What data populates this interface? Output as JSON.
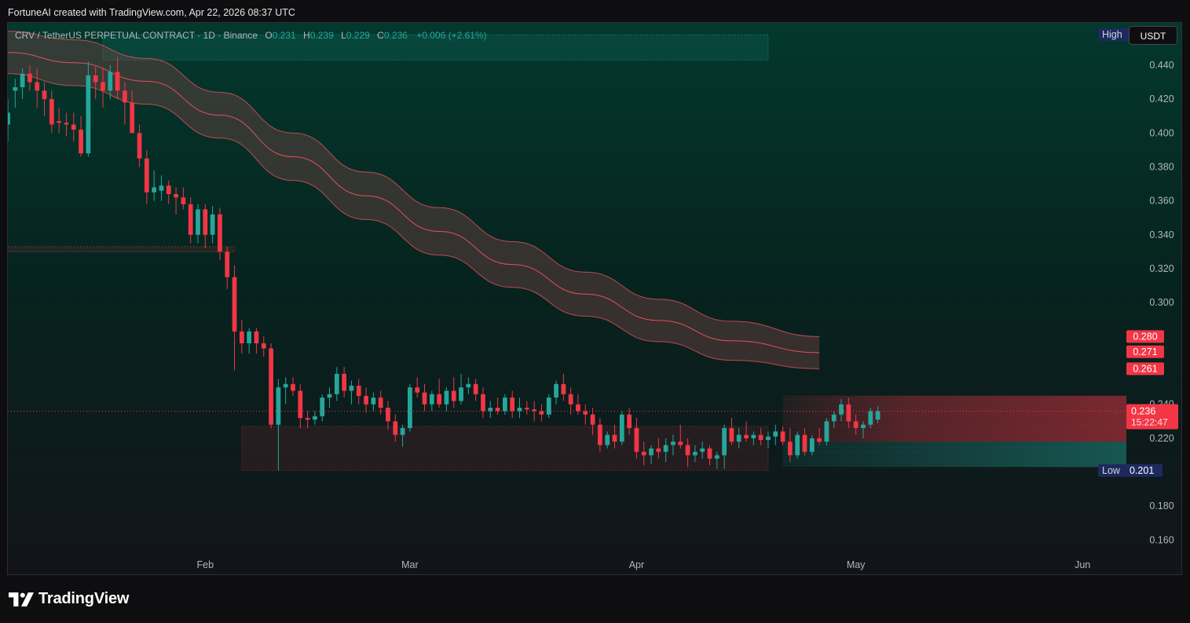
{
  "credit": "FortuneAI created with TradingView.com, Apr 22, 2026 08:37 UTC",
  "legend": {
    "symbol": "CRV / TetherUS PERPETUAL CONTRACT · 1D · Binance",
    "o_label": "O",
    "o": "0.231",
    "h_label": "H",
    "h": "0.239",
    "l_label": "L",
    "l": "0.229",
    "c_label": "C",
    "c": "0.236",
    "change": "+0.006 (+2.61%)"
  },
  "currency": "USDT",
  "brand": "TradingView",
  "colors": {
    "up": "#26a69a",
    "down": "#f23645",
    "band": "#f7525f",
    "bg_top": "#03352c",
    "bg_bottom": "#121419"
  },
  "chart_data": {
    "type": "candlestick",
    "ylim": [
      0.15,
      0.465
    ],
    "y_ticks": [
      "0.440",
      "0.420",
      "0.400",
      "0.380",
      "0.360",
      "0.340",
      "0.320",
      "0.300",
      "0.240",
      "0.220",
      "0.180",
      "0.160"
    ],
    "x_labels": [
      {
        "label": "Feb",
        "day": 18
      },
      {
        "label": "Mar",
        "day": 46
      },
      {
        "label": "Apr",
        "day": 77
      },
      {
        "label": "May",
        "day": 107
      },
      {
        "label": "Jun",
        "day": 138
      }
    ],
    "x_range": [
      -9,
      144
    ],
    "high": {
      "label": "High",
      "value": 0.458
    },
    "low": {
      "label": "Low",
      "value": 0.201
    },
    "price_tags": [
      {
        "value": "0.280",
        "price": 0.28
      },
      {
        "value": "0.271",
        "price": 0.271
      },
      {
        "value": "0.261",
        "price": 0.261
      }
    ],
    "last": {
      "value": "0.236",
      "price": 0.236,
      "countdown": "15:22:47"
    },
    "zones": [
      {
        "kind": "supply",
        "day_from": 4,
        "day_to": 95,
        "top": 0.458,
        "bottom": 0.443
      },
      {
        "kind": "level",
        "day_from": -9,
        "day_to": 22,
        "top": 0.333,
        "bottom": 0.33
      },
      {
        "kind": "demand",
        "day_from": 23,
        "day_to": 95,
        "top": 0.227,
        "bottom": 0.201
      }
    ],
    "band": [
      {
        "day": -9,
        "upper": 0.46,
        "lower": 0.435
      },
      {
        "day": 0,
        "upper": 0.455,
        "lower": 0.428
      },
      {
        "day": 10,
        "upper": 0.444,
        "lower": 0.417
      },
      {
        "day": 20,
        "upper": 0.424,
        "lower": 0.397
      },
      {
        "day": 30,
        "upper": 0.4,
        "lower": 0.372
      },
      {
        "day": 40,
        "upper": 0.377,
        "lower": 0.349
      },
      {
        "day": 50,
        "upper": 0.356,
        "lower": 0.328
      },
      {
        "day": 60,
        "upper": 0.336,
        "lower": 0.309
      },
      {
        "day": 70,
        "upper": 0.318,
        "lower": 0.292
      },
      {
        "day": 80,
        "upper": 0.302,
        "lower": 0.277
      },
      {
        "day": 90,
        "upper": 0.289,
        "lower": 0.266
      },
      {
        "day": 102,
        "upper": 0.28,
        "lower": 0.261
      }
    ],
    "candles": [
      {
        "d": -9,
        "o": 0.405,
        "h": 0.42,
        "l": 0.395,
        "c": 0.412
      },
      {
        "d": -8,
        "o": 0.425,
        "h": 0.432,
        "l": 0.415,
        "c": 0.427
      },
      {
        "d": -7,
        "o": 0.427,
        "h": 0.438,
        "l": 0.42,
        "c": 0.435
      },
      {
        "d": -6,
        "o": 0.435,
        "h": 0.44,
        "l": 0.425,
        "c": 0.43
      },
      {
        "d": -5,
        "o": 0.43,
        "h": 0.438,
        "l": 0.415,
        "c": 0.425
      },
      {
        "d": -4,
        "o": 0.425,
        "h": 0.43,
        "l": 0.41,
        "c": 0.42
      },
      {
        "d": -3,
        "o": 0.42,
        "h": 0.425,
        "l": 0.4,
        "c": 0.405
      },
      {
        "d": -2,
        "o": 0.407,
        "h": 0.415,
        "l": 0.4,
        "c": 0.406
      },
      {
        "d": -1,
        "o": 0.406,
        "h": 0.412,
        "l": 0.398,
        "c": 0.405
      },
      {
        "d": 0,
        "o": 0.405,
        "h": 0.412,
        "l": 0.395,
        "c": 0.402
      },
      {
        "d": 1,
        "o": 0.402,
        "h": 0.41,
        "l": 0.386,
        "c": 0.388
      },
      {
        "d": 2,
        "o": 0.388,
        "h": 0.442,
        "l": 0.386,
        "c": 0.434
      },
      {
        "d": 3,
        "o": 0.434,
        "h": 0.44,
        "l": 0.42,
        "c": 0.43
      },
      {
        "d": 4,
        "o": 0.43,
        "h": 0.438,
        "l": 0.415,
        "c": 0.425
      },
      {
        "d": 5,
        "o": 0.425,
        "h": 0.44,
        "l": 0.42,
        "c": 0.436
      },
      {
        "d": 6,
        "o": 0.436,
        "h": 0.445,
        "l": 0.42,
        "c": 0.425
      },
      {
        "d": 7,
        "o": 0.425,
        "h": 0.43,
        "l": 0.405,
        "c": 0.418
      },
      {
        "d": 8,
        "o": 0.418,
        "h": 0.425,
        "l": 0.4,
        "c": 0.4
      },
      {
        "d": 9,
        "o": 0.4,
        "h": 0.405,
        "l": 0.38,
        "c": 0.385
      },
      {
        "d": 10,
        "o": 0.385,
        "h": 0.39,
        "l": 0.358,
        "c": 0.365
      },
      {
        "d": 11,
        "o": 0.365,
        "h": 0.378,
        "l": 0.36,
        "c": 0.368
      },
      {
        "d": 12,
        "o": 0.366,
        "h": 0.375,
        "l": 0.36,
        "c": 0.369
      },
      {
        "d": 13,
        "o": 0.369,
        "h": 0.372,
        "l": 0.358,
        "c": 0.364
      },
      {
        "d": 14,
        "o": 0.364,
        "h": 0.368,
        "l": 0.352,
        "c": 0.362
      },
      {
        "d": 15,
        "o": 0.362,
        "h": 0.368,
        "l": 0.355,
        "c": 0.358
      },
      {
        "d": 16,
        "o": 0.358,
        "h": 0.362,
        "l": 0.335,
        "c": 0.34
      },
      {
        "d": 17,
        "o": 0.34,
        "h": 0.358,
        "l": 0.335,
        "c": 0.355
      },
      {
        "d": 18,
        "o": 0.355,
        "h": 0.358,
        "l": 0.332,
        "c": 0.34
      },
      {
        "d": 19,
        "o": 0.34,
        "h": 0.357,
        "l": 0.335,
        "c": 0.352
      },
      {
        "d": 20,
        "o": 0.352,
        "h": 0.356,
        "l": 0.325,
        "c": 0.33
      },
      {
        "d": 21,
        "o": 0.33,
        "h": 0.333,
        "l": 0.308,
        "c": 0.315
      },
      {
        "d": 22,
        "o": 0.315,
        "h": 0.322,
        "l": 0.26,
        "c": 0.283
      },
      {
        "d": 23,
        "o": 0.283,
        "h": 0.29,
        "l": 0.27,
        "c": 0.276
      },
      {
        "d": 24,
        "o": 0.276,
        "h": 0.285,
        "l": 0.27,
        "c": 0.283
      },
      {
        "d": 25,
        "o": 0.283,
        "h": 0.285,
        "l": 0.27,
        "c": 0.276
      },
      {
        "d": 26,
        "o": 0.276,
        "h": 0.28,
        "l": 0.268,
        "c": 0.273
      },
      {
        "d": 27,
        "o": 0.273,
        "h": 0.276,
        "l": 0.226,
        "c": 0.228
      },
      {
        "d": 28,
        "o": 0.228,
        "h": 0.255,
        "l": 0.201,
        "c": 0.25
      },
      {
        "d": 29,
        "o": 0.25,
        "h": 0.256,
        "l": 0.24,
        "c": 0.252
      },
      {
        "d": 30,
        "o": 0.252,
        "h": 0.256,
        "l": 0.245,
        "c": 0.248
      },
      {
        "d": 31,
        "o": 0.248,
        "h": 0.252,
        "l": 0.226,
        "c": 0.232
      },
      {
        "d": 32,
        "o": 0.232,
        "h": 0.236,
        "l": 0.226,
        "c": 0.231
      },
      {
        "d": 33,
        "o": 0.231,
        "h": 0.236,
        "l": 0.228,
        "c": 0.233
      },
      {
        "d": 34,
        "o": 0.233,
        "h": 0.246,
        "l": 0.23,
        "c": 0.244
      },
      {
        "d": 35,
        "o": 0.244,
        "h": 0.25,
        "l": 0.238,
        "c": 0.246
      },
      {
        "d": 36,
        "o": 0.246,
        "h": 0.262,
        "l": 0.242,
        "c": 0.258
      },
      {
        "d": 37,
        "o": 0.258,
        "h": 0.262,
        "l": 0.244,
        "c": 0.248
      },
      {
        "d": 38,
        "o": 0.248,
        "h": 0.254,
        "l": 0.24,
        "c": 0.251
      },
      {
        "d": 39,
        "o": 0.251,
        "h": 0.255,
        "l": 0.24,
        "c": 0.245
      },
      {
        "d": 40,
        "o": 0.245,
        "h": 0.25,
        "l": 0.235,
        "c": 0.24
      },
      {
        "d": 41,
        "o": 0.24,
        "h": 0.247,
        "l": 0.236,
        "c": 0.244
      },
      {
        "d": 42,
        "o": 0.244,
        "h": 0.248,
        "l": 0.234,
        "c": 0.238
      },
      {
        "d": 43,
        "o": 0.238,
        "h": 0.242,
        "l": 0.225,
        "c": 0.23
      },
      {
        "d": 44,
        "o": 0.23,
        "h": 0.234,
        "l": 0.218,
        "c": 0.222
      },
      {
        "d": 45,
        "o": 0.222,
        "h": 0.228,
        "l": 0.215,
        "c": 0.226
      },
      {
        "d": 46,
        "o": 0.226,
        "h": 0.252,
        "l": 0.224,
        "c": 0.25
      },
      {
        "d": 47,
        "o": 0.25,
        "h": 0.256,
        "l": 0.244,
        "c": 0.247
      },
      {
        "d": 48,
        "o": 0.247,
        "h": 0.252,
        "l": 0.236,
        "c": 0.24
      },
      {
        "d": 49,
        "o": 0.24,
        "h": 0.248,
        "l": 0.236,
        "c": 0.246
      },
      {
        "d": 50,
        "o": 0.246,
        "h": 0.255,
        "l": 0.238,
        "c": 0.24
      },
      {
        "d": 51,
        "o": 0.24,
        "h": 0.25,
        "l": 0.236,
        "c": 0.248
      },
      {
        "d": 52,
        "o": 0.248,
        "h": 0.256,
        "l": 0.238,
        "c": 0.242
      },
      {
        "d": 53,
        "o": 0.242,
        "h": 0.258,
        "l": 0.24,
        "c": 0.25
      },
      {
        "d": 54,
        "o": 0.25,
        "h": 0.256,
        "l": 0.246,
        "c": 0.252
      },
      {
        "d": 55,
        "o": 0.252,
        "h": 0.255,
        "l": 0.242,
        "c": 0.246
      },
      {
        "d": 56,
        "o": 0.246,
        "h": 0.25,
        "l": 0.232,
        "c": 0.236
      },
      {
        "d": 57,
        "o": 0.236,
        "h": 0.242,
        "l": 0.232,
        "c": 0.238
      },
      {
        "d": 58,
        "o": 0.238,
        "h": 0.244,
        "l": 0.234,
        "c": 0.236
      },
      {
        "d": 59,
        "o": 0.236,
        "h": 0.246,
        "l": 0.234,
        "c": 0.244
      },
      {
        "d": 60,
        "o": 0.244,
        "h": 0.248,
        "l": 0.232,
        "c": 0.236
      },
      {
        "d": 61,
        "o": 0.236,
        "h": 0.244,
        "l": 0.232,
        "c": 0.238
      },
      {
        "d": 62,
        "o": 0.238,
        "h": 0.242,
        "l": 0.234,
        "c": 0.237
      },
      {
        "d": 63,
        "o": 0.237,
        "h": 0.242,
        "l": 0.23,
        "c": 0.236
      },
      {
        "d": 64,
        "o": 0.236,
        "h": 0.24,
        "l": 0.23,
        "c": 0.234
      },
      {
        "d": 65,
        "o": 0.234,
        "h": 0.246,
        "l": 0.232,
        "c": 0.244
      },
      {
        "d": 66,
        "o": 0.244,
        "h": 0.254,
        "l": 0.24,
        "c": 0.252
      },
      {
        "d": 67,
        "o": 0.252,
        "h": 0.258,
        "l": 0.242,
        "c": 0.246
      },
      {
        "d": 68,
        "o": 0.246,
        "h": 0.25,
        "l": 0.234,
        "c": 0.24
      },
      {
        "d": 69,
        "o": 0.24,
        "h": 0.246,
        "l": 0.234,
        "c": 0.236
      },
      {
        "d": 70,
        "o": 0.236,
        "h": 0.24,
        "l": 0.228,
        "c": 0.234
      },
      {
        "d": 71,
        "o": 0.234,
        "h": 0.238,
        "l": 0.222,
        "c": 0.228
      },
      {
        "d": 72,
        "o": 0.228,
        "h": 0.232,
        "l": 0.212,
        "c": 0.216
      },
      {
        "d": 73,
        "o": 0.216,
        "h": 0.224,
        "l": 0.214,
        "c": 0.222
      },
      {
        "d": 74,
        "o": 0.222,
        "h": 0.228,
        "l": 0.214,
        "c": 0.218
      },
      {
        "d": 75,
        "o": 0.218,
        "h": 0.236,
        "l": 0.216,
        "c": 0.234
      },
      {
        "d": 76,
        "o": 0.234,
        "h": 0.238,
        "l": 0.222,
        "c": 0.226
      },
      {
        "d": 77,
        "o": 0.226,
        "h": 0.232,
        "l": 0.208,
        "c": 0.212
      },
      {
        "d": 78,
        "o": 0.212,
        "h": 0.218,
        "l": 0.204,
        "c": 0.21
      },
      {
        "d": 79,
        "o": 0.21,
        "h": 0.216,
        "l": 0.205,
        "c": 0.214
      },
      {
        "d": 80,
        "o": 0.214,
        "h": 0.22,
        "l": 0.208,
        "c": 0.212
      },
      {
        "d": 81,
        "o": 0.212,
        "h": 0.22,
        "l": 0.206,
        "c": 0.216
      },
      {
        "d": 82,
        "o": 0.216,
        "h": 0.222,
        "l": 0.21,
        "c": 0.218
      },
      {
        "d": 83,
        "o": 0.218,
        "h": 0.228,
        "l": 0.214,
        "c": 0.216
      },
      {
        "d": 84,
        "o": 0.216,
        "h": 0.22,
        "l": 0.203,
        "c": 0.21
      },
      {
        "d": 85,
        "o": 0.21,
        "h": 0.216,
        "l": 0.206,
        "c": 0.212
      },
      {
        "d": 86,
        "o": 0.212,
        "h": 0.218,
        "l": 0.208,
        "c": 0.214
      },
      {
        "d": 87,
        "o": 0.214,
        "h": 0.216,
        "l": 0.204,
        "c": 0.208
      },
      {
        "d": 88,
        "o": 0.208,
        "h": 0.212,
        "l": 0.202,
        "c": 0.21
      },
      {
        "d": 89,
        "o": 0.21,
        "h": 0.228,
        "l": 0.202,
        "c": 0.226
      },
      {
        "d": 90,
        "o": 0.226,
        "h": 0.232,
        "l": 0.216,
        "c": 0.218
      },
      {
        "d": 91,
        "o": 0.218,
        "h": 0.226,
        "l": 0.214,
        "c": 0.222
      },
      {
        "d": 92,
        "o": 0.222,
        "h": 0.23,
        "l": 0.218,
        "c": 0.22
      },
      {
        "d": 93,
        "o": 0.22,
        "h": 0.224,
        "l": 0.216,
        "c": 0.222
      },
      {
        "d": 94,
        "o": 0.222,
        "h": 0.226,
        "l": 0.216,
        "c": 0.219
      },
      {
        "d": 95,
        "o": 0.219,
        "h": 0.224,
        "l": 0.214,
        "c": 0.221
      },
      {
        "d": 96,
        "o": 0.221,
        "h": 0.228,
        "l": 0.216,
        "c": 0.224
      },
      {
        "d": 97,
        "o": 0.224,
        "h": 0.227,
        "l": 0.216,
        "c": 0.218
      },
      {
        "d": 98,
        "o": 0.218,
        "h": 0.226,
        "l": 0.206,
        "c": 0.21
      },
      {
        "d": 99,
        "o": 0.21,
        "h": 0.224,
        "l": 0.208,
        "c": 0.222
      },
      {
        "d": 100,
        "o": 0.222,
        "h": 0.226,
        "l": 0.21,
        "c": 0.212
      },
      {
        "d": 101,
        "o": 0.212,
        "h": 0.222,
        "l": 0.21,
        "c": 0.22
      },
      {
        "d": 102,
        "o": 0.22,
        "h": 0.226,
        "l": 0.216,
        "c": 0.218
      },
      {
        "d": 103,
        "o": 0.218,
        "h": 0.232,
        "l": 0.216,
        "c": 0.23
      },
      {
        "d": 104,
        "o": 0.23,
        "h": 0.236,
        "l": 0.226,
        "c": 0.234
      },
      {
        "d": 105,
        "o": 0.234,
        "h": 0.243,
        "l": 0.23,
        "c": 0.24
      },
      {
        "d": 106,
        "o": 0.24,
        "h": 0.244,
        "l": 0.226,
        "c": 0.23
      },
      {
        "d": 107,
        "o": 0.23,
        "h": 0.234,
        "l": 0.222,
        "c": 0.226
      },
      {
        "d": 108,
        "o": 0.226,
        "h": 0.23,
        "l": 0.22,
        "c": 0.228
      },
      {
        "d": 109,
        "o": 0.228,
        "h": 0.238,
        "l": 0.226,
        "c": 0.236
      },
      {
        "d": 110,
        "o": 0.231,
        "h": 0.239,
        "l": 0.229,
        "c": 0.236
      }
    ]
  }
}
